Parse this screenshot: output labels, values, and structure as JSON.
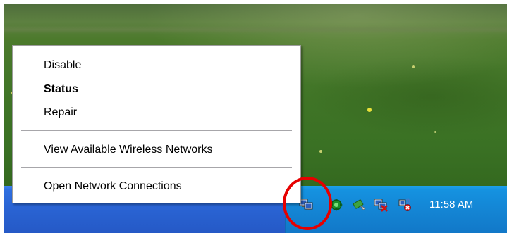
{
  "context_menu": {
    "items": [
      {
        "label": "Disable",
        "bold": false
      },
      {
        "label": "Status",
        "bold": true
      },
      {
        "label": "Repair",
        "bold": false
      },
      {
        "label": "View Available Wireless Networks",
        "bold": false
      },
      {
        "label": "Open Network Connections",
        "bold": false
      }
    ]
  },
  "system_tray": {
    "icons": [
      "network-connection-icon",
      "green-security-icon",
      "safely-remove-hardware-icon",
      "network-disconnected-icon",
      "wireless-disconnected-icon"
    ],
    "clock": "11:58 AM"
  },
  "annotation": {
    "color": "#e60000",
    "target": "network-connection-icon"
  },
  "colors": {
    "taskbar": "#2a64d4",
    "tray": "#1592e0"
  }
}
